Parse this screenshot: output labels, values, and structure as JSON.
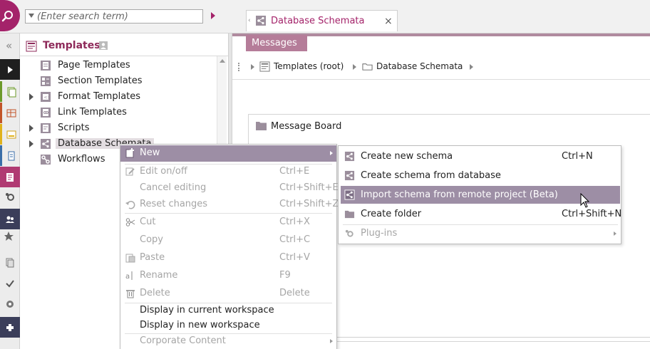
{
  "search": {
    "placeholder": "(Enter search term)"
  },
  "doc_tab": {
    "label": "Database Schemata",
    "close": "×"
  },
  "tree": {
    "collapse": "«",
    "title": "Templates",
    "items": [
      {
        "label": "Page Templates"
      },
      {
        "label": "Section Templates"
      },
      {
        "label": "Format Templates"
      },
      {
        "label": "Link Templates"
      },
      {
        "label": "Scripts"
      },
      {
        "label": "Database Schemata"
      },
      {
        "label": "Workflows"
      }
    ]
  },
  "messages_tab": {
    "label": "Messages"
  },
  "breadcrumb": {
    "root": "Templates (root)",
    "current": "Database Schemata"
  },
  "board": {
    "title": "Message Board"
  },
  "context_menu": {
    "items": [
      {
        "label": "New",
        "shortcut": ""
      },
      {
        "label": "Edit on/off",
        "shortcut": "Ctrl+E"
      },
      {
        "label": "Cancel editing",
        "shortcut": "Ctrl+Shift+E"
      },
      {
        "label": "Reset changes",
        "shortcut": "Ctrl+Shift+Z"
      },
      {
        "label": "Cut",
        "shortcut": "Ctrl+X"
      },
      {
        "label": "Copy",
        "shortcut": "Ctrl+C"
      },
      {
        "label": "Paste",
        "shortcut": "Ctrl+V"
      },
      {
        "label": "Rename",
        "shortcut": "F9"
      },
      {
        "label": "Delete",
        "shortcut": "Delete"
      },
      {
        "label": "Display in current workspace",
        "shortcut": ""
      },
      {
        "label": "Display in new workspace",
        "shortcut": ""
      },
      {
        "label": "Corporate Content",
        "shortcut": ""
      }
    ]
  },
  "submenu": {
    "items": [
      {
        "label": "Create new schema",
        "shortcut": "Ctrl+N"
      },
      {
        "label": "Create schema from database",
        "shortcut": ""
      },
      {
        "label": "Import schema from remote project (Beta)",
        "shortcut": ""
      },
      {
        "label": "Create folder",
        "shortcut": "Ctrl+Shift+N"
      },
      {
        "label": "Plug-ins",
        "shortcut": ""
      }
    ]
  },
  "colors": {
    "brand": "#a4236a",
    "menu_highlight": "#9d8ea5",
    "title": "#8e2a5a",
    "messages_tab": "#b57d99"
  }
}
